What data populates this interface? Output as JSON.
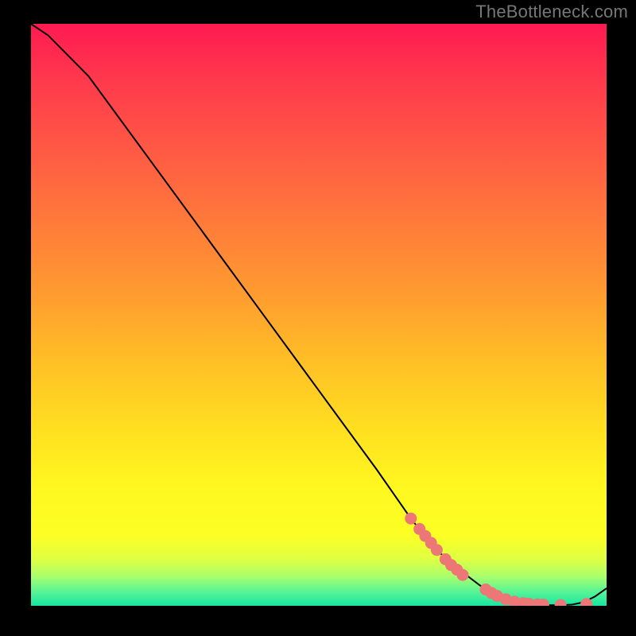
{
  "attribution": "TheBottleneck.com",
  "chart_data": {
    "type": "line",
    "title": "",
    "xlabel": "",
    "ylabel": "",
    "xlim": [
      0,
      100
    ],
    "ylim": [
      0,
      100
    ],
    "curve": {
      "name": "bottleneck-curve",
      "x": [
        0,
        3,
        6,
        10,
        20,
        30,
        40,
        50,
        60,
        66,
        70,
        74,
        78,
        82,
        86,
        88,
        90,
        92,
        94,
        96,
        98,
        100
      ],
      "y": [
        100,
        98,
        95,
        91,
        77.5,
        64,
        50.5,
        37,
        23.5,
        15,
        10,
        6.5,
        3.5,
        1.5,
        0.5,
        0.2,
        0.1,
        0.1,
        0.2,
        0.6,
        1.6,
        3.0
      ]
    },
    "scatter": {
      "name": "sample-points",
      "x": [
        66,
        67.5,
        68.5,
        69.5,
        70.5,
        72,
        73,
        74,
        75,
        79,
        80,
        81,
        82.5,
        84,
        85.5,
        86.5,
        88,
        89,
        92,
        96.5
      ],
      "y": [
        15,
        13.2,
        12,
        10.8,
        9.6,
        8,
        7,
        6.2,
        5.3,
        2.8,
        2.2,
        1.7,
        1.1,
        0.7,
        0.45,
        0.35,
        0.25,
        0.2,
        0.12,
        0.3
      ]
    },
    "gradient_stops": [
      {
        "pos": 0,
        "color": "#ff1a51"
      },
      {
        "pos": 0.5,
        "color": "#ffbf26"
      },
      {
        "pos": 0.85,
        "color": "#fff820"
      },
      {
        "pos": 1.0,
        "color": "#17e6a2"
      }
    ]
  }
}
